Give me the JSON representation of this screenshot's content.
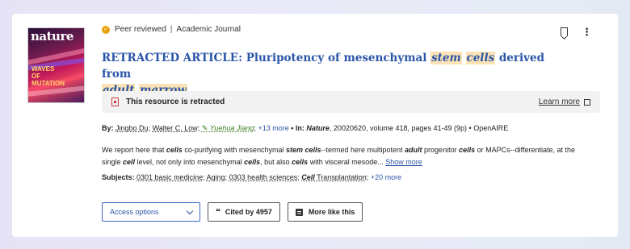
{
  "cover": {
    "masthead": "nature",
    "headline": "WAVES OF MUTATION"
  },
  "meta": {
    "peer_reviewed": "Peer reviewed",
    "separator": "|",
    "type": "Academic Journal"
  },
  "icons": {
    "bookmark": "bookmark-icon",
    "more": "kebab-icon",
    "check": "check-icon",
    "retracted": "document-icon",
    "external": "external-link-icon",
    "cite": "quote-icon",
    "more_like": "list-icon"
  },
  "title": {
    "prefix": "RETRACTED ARTICLE: Pluripotency of mesenchymal ",
    "hl1": "stem",
    "sp1": " ",
    "hl2": "cells",
    "mid": " derived from",
    "hl3": "adult",
    "sp2": " ",
    "hl4": "marrow"
  },
  "retraction": {
    "text": "This resource is retracted",
    "learn_more": "Learn more"
  },
  "byline": {
    "by_label": "By:",
    "author1": "Jingbo Du",
    "sep1": ";",
    "author2": "Walter C. Low",
    "sep2": ";",
    "author3": "Yuehua Jiang",
    "sep3": ";",
    "more_authors": "+13 more",
    "in_label": "• In:",
    "journal": "Nature",
    "details": ", 20020620, volume 418, pages 41-49 (9p) • OpenAIRE"
  },
  "abstract": {
    "t1": "We report here that ",
    "k1": "cells",
    "t2": " co-purifying with mesenchymal ",
    "k2": "stem cells",
    "t3": "--termed here multipotent ",
    "k3": "adult",
    "t4": " progenitor ",
    "k4": "cells",
    "t5": " or MAPCs--differentiate, at the single ",
    "k5": "cell",
    "t6": " level, not only into mesenchymal ",
    "k6": "cells",
    "t7": ", but also ",
    "k7": "cells",
    "t8": " with visceral mesode...",
    "show_more": "Show more"
  },
  "subjects": {
    "label": "Subjects:",
    "s1": "0301 basic medicine",
    "s2": "Aging",
    "s3": "0303 health sciences",
    "s4_bold": "Cell",
    "s4_rest": " Transplantation",
    "more": "+20 more"
  },
  "actions": {
    "access": "Access options",
    "cited": "Cited by 4957",
    "more_like": "More like this"
  },
  "colors": {
    "link": "#2a55a8",
    "highlight": "#fbe3b5",
    "retract_red": "#d23b3b",
    "orcid_green": "#3a7d1e",
    "peer_badge": "#e8a20c"
  }
}
